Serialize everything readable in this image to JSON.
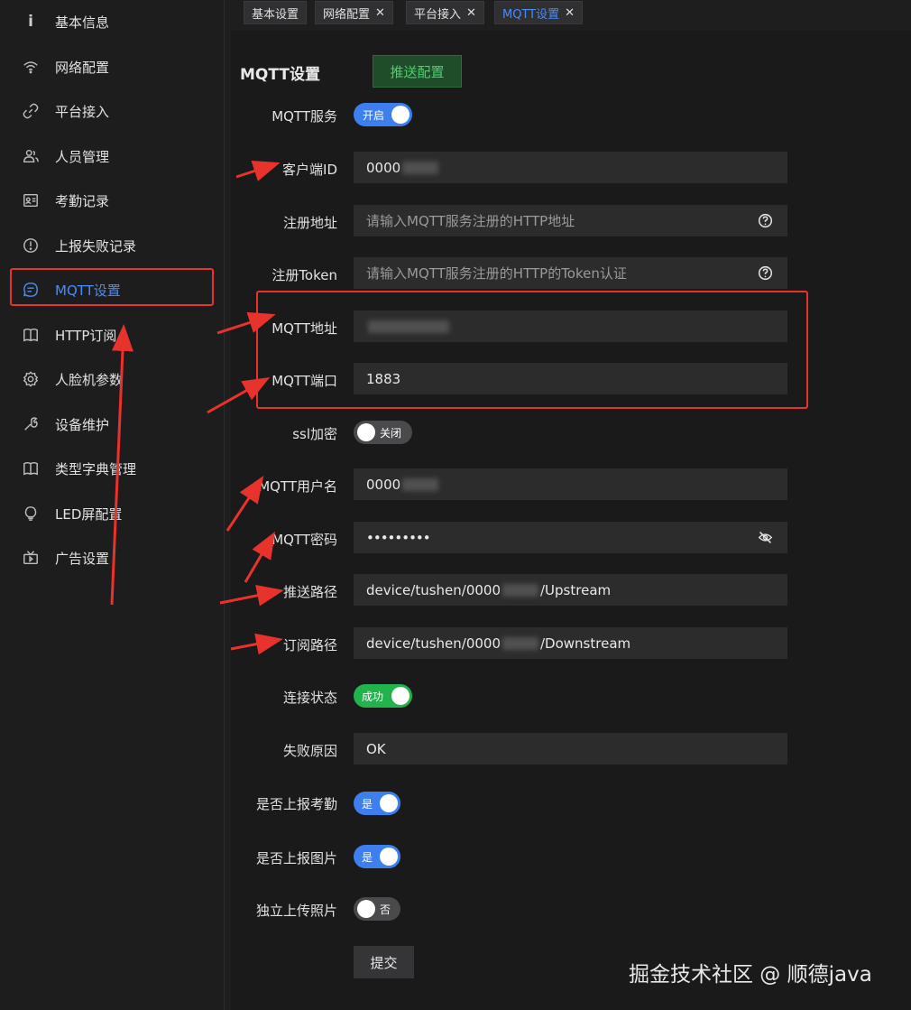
{
  "sidebar": {
    "items": [
      {
        "label": "基本信息",
        "icon": "info-icon"
      },
      {
        "label": "网络配置",
        "icon": "wifi-icon"
      },
      {
        "label": "平台接入",
        "icon": "link-icon"
      },
      {
        "label": "人员管理",
        "icon": "users-icon"
      },
      {
        "label": "考勤记录",
        "icon": "id-card-icon"
      },
      {
        "label": "上报失败记录",
        "icon": "alert-icon"
      },
      {
        "label": "MQTT设置",
        "icon": "message-icon",
        "active": true
      },
      {
        "label": "HTTP订阅",
        "icon": "book-icon"
      },
      {
        "label": "人脸机参数",
        "icon": "gear-icon"
      },
      {
        "label": "设备维护",
        "icon": "wrench-icon"
      },
      {
        "label": "类型字典管理",
        "icon": "book-icon"
      },
      {
        "label": "LED屏配置",
        "icon": "bulb-icon"
      },
      {
        "label": "广告设置",
        "icon": "tv-icon"
      }
    ]
  },
  "tabs": [
    {
      "label": "基本设置",
      "closable": false
    },
    {
      "label": "网络配置",
      "closable": true
    },
    {
      "label": "平台接入",
      "closable": true
    },
    {
      "label": "MQTT设置",
      "closable": true,
      "active": true
    }
  ],
  "form": {
    "title": "MQTT设置",
    "push_button": "推送配置",
    "mqtt_service": {
      "label": "MQTT服务",
      "state": "开启"
    },
    "client_id": {
      "label": "客户端ID",
      "value": "0000"
    },
    "register_url": {
      "label": "注册地址",
      "placeholder": "请输入MQTT服务注册的HTTP地址"
    },
    "register_token": {
      "label": "注册Token",
      "placeholder": "请输入MQTT服务注册的HTTP的Token认证"
    },
    "mqtt_address": {
      "label": "MQTT地址",
      "value": ""
    },
    "mqtt_port": {
      "label": "MQTT端口",
      "value": "1883"
    },
    "ssl": {
      "label": "ssl加密",
      "state": "关闭"
    },
    "username": {
      "label": "MQTT用户名",
      "value": "0000"
    },
    "password": {
      "label": "MQTT密码",
      "value": "•••••••••"
    },
    "push_path": {
      "label": "推送路径",
      "prefix": "device/tushen/0000",
      "suffix": "/Upstream"
    },
    "sub_path": {
      "label": "订阅路径",
      "prefix": "device/tushen/0000",
      "suffix": "/Downstream"
    },
    "conn_status": {
      "label": "连接状态",
      "state": "成功"
    },
    "fail_reason": {
      "label": "失败原因",
      "value": "OK"
    },
    "report_attendance": {
      "label": "是否上报考勤",
      "state": "是"
    },
    "report_image": {
      "label": "是否上报图片",
      "state": "是"
    },
    "upload_photo": {
      "label": "独立上传照片",
      "state": "否"
    },
    "submit": "提交"
  },
  "watermark": "掘金技术社区 @ 顺德java",
  "colors": {
    "accent": "#4c8cf5",
    "success": "#22b34c",
    "annotation": "#e8322c"
  }
}
